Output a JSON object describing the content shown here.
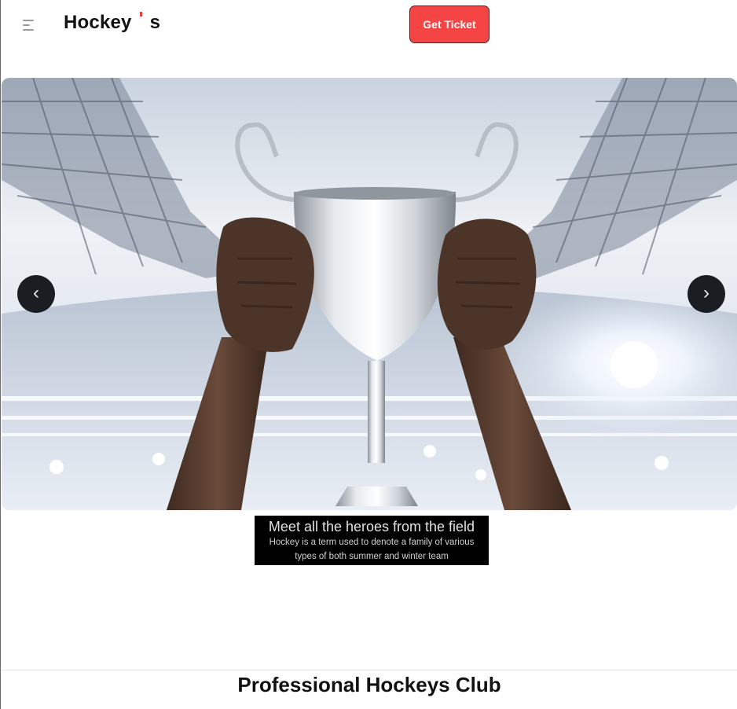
{
  "header": {
    "brand_start": "Hockey",
    "brand_end": "s",
    "ticket_label": "Get Ticket"
  },
  "hero": {
    "prev_label": "‹",
    "next_label": "›",
    "caption_title": "Meet all the heroes from the field",
    "caption_text": "Hockey is a term used to denote a family of various types of both summer and winter team"
  },
  "section": {
    "title": "Professional Hockeys Club"
  },
  "colors": {
    "accent": "#f54444",
    "dark": "#1a1d22"
  },
  "icons": {
    "menu": "menu-icon",
    "prev": "chevron-left-icon",
    "next": "chevron-right-icon"
  }
}
